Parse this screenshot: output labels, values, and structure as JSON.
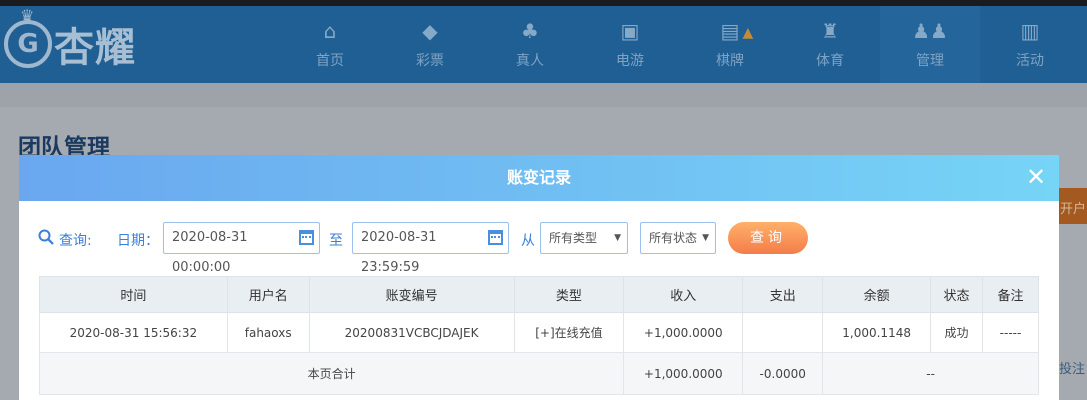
{
  "header": {
    "brand": "杏耀",
    "nav": [
      {
        "label": "首页",
        "icon": "home-icon"
      },
      {
        "label": "彩票",
        "icon": "lottery-ticket-icon"
      },
      {
        "label": "真人",
        "icon": "live-dealer-icon"
      },
      {
        "label": "电游",
        "icon": "slot-machine-icon"
      },
      {
        "label": "棋牌",
        "icon": "card-game-icon"
      },
      {
        "label": "体育",
        "icon": "trophy-icon"
      },
      {
        "label": "管理",
        "icon": "users-icon"
      },
      {
        "label": "活动",
        "icon": "gift-icon"
      }
    ]
  },
  "page": {
    "title": "团队管理",
    "side_button": "开户",
    "side_link": "投注"
  },
  "modal": {
    "title": "账变记录",
    "close_icon": "close-icon",
    "query": {
      "label": "查询:",
      "date_label": "日期：",
      "start_date": "2020-08-31 00:00:00",
      "to_label": "至",
      "end_date": "2020-08-31 23:59:59",
      "from_label": "从",
      "type_select": "所有类型",
      "status_select": "所有状态",
      "query_button": "查询"
    },
    "table": {
      "headers": [
        "时间",
        "用户名",
        "账变编号",
        "类型",
        "收入",
        "支出",
        "余额",
        "状态",
        "备注"
      ],
      "rows": [
        {
          "time": "2020-08-31 15:56:32",
          "username": "fahaoxs",
          "record_id": "20200831VCBCJDAJEK",
          "type": "[+]在线充值",
          "income": "+1,000.0000",
          "expense": "",
          "balance": "1,000.1148",
          "status": "成功",
          "note": "-----"
        }
      ],
      "summary": {
        "label": "本页合计",
        "income": "+1,000.0000",
        "expense": "-0.0000",
        "rest": "--"
      }
    }
  },
  "colors": {
    "accent_blue": "#3b7fd6",
    "income_green": "#4e8a2e",
    "query_button_orange": "#f47d49"
  }
}
